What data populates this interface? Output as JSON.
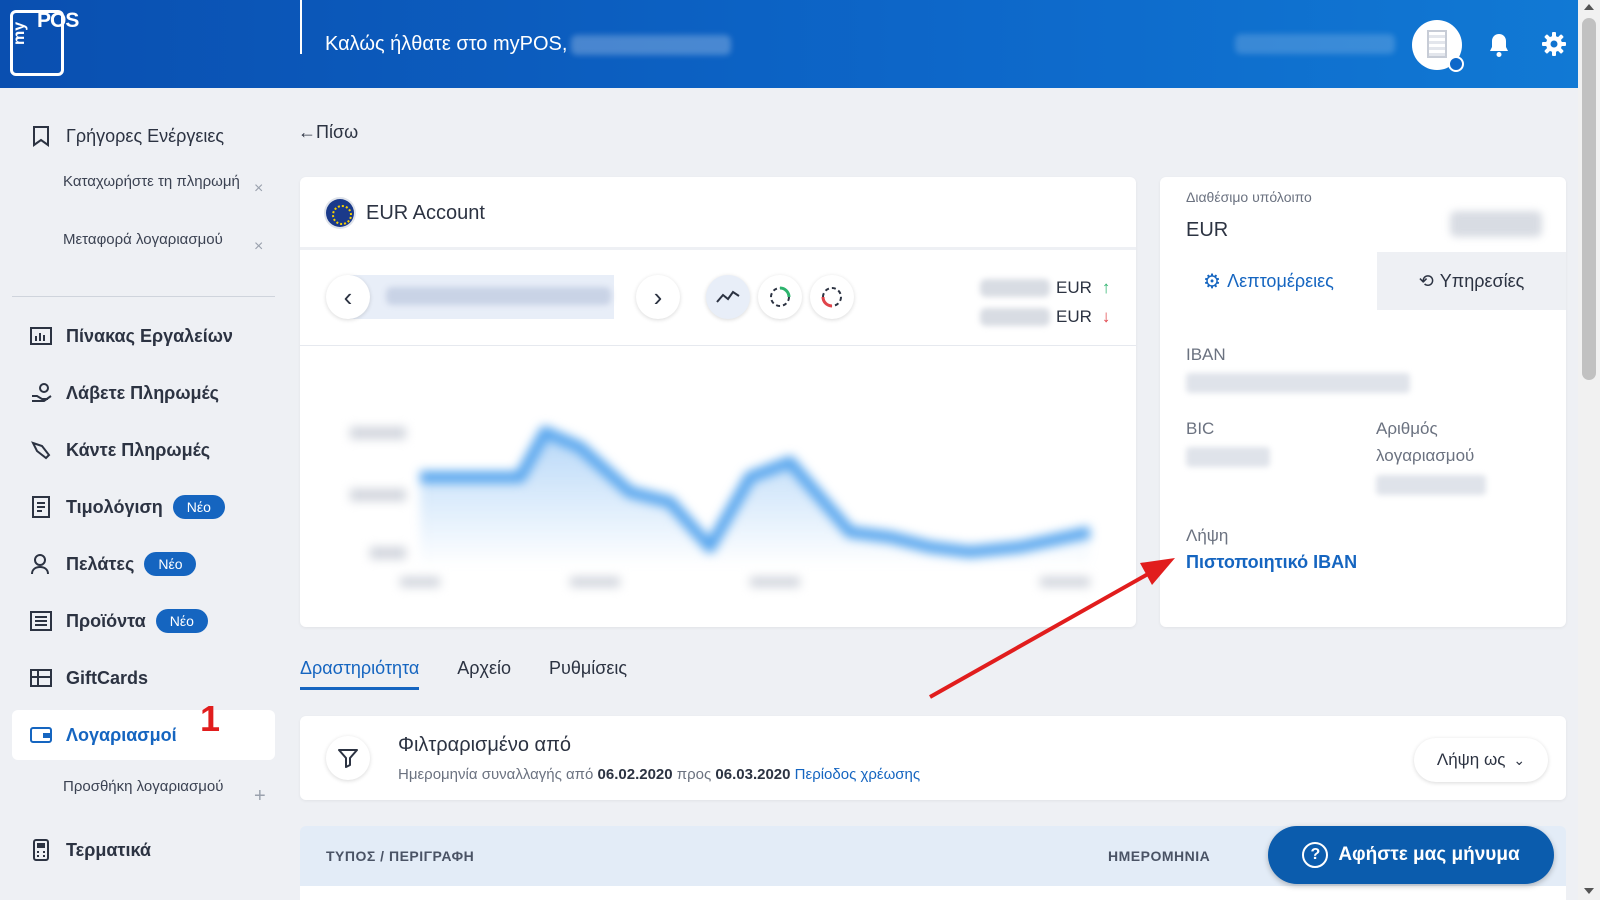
{
  "header": {
    "logo_text_pos": "POS",
    "logo_text_my": "my",
    "welcome": "Καλώς ήλθατε στο myPOS,"
  },
  "sidebar": {
    "quick_actions": "Γρήγορες Ενέργειες",
    "quick_sub": [
      {
        "label": "Καταχωρήστε τη πληρωμή"
      },
      {
        "label": "Μεταφορά λογαριασμού"
      }
    ],
    "remove_symbol": "×",
    "items": [
      {
        "label": "Πίνακας Εργαλείων"
      },
      {
        "label": "Λάβετε Πληρωμές"
      },
      {
        "label": "Κάντε Πληρωμές"
      },
      {
        "label": "Τιμολόγιση",
        "badge": "Νέο"
      },
      {
        "label": "Πελάτες",
        "badge": "Νέο"
      },
      {
        "label": "Προϊόντα",
        "badge": "Νέο"
      },
      {
        "label": "GiftCards"
      },
      {
        "label": "Λογαριασμοί"
      },
      {
        "label": "Τερματικά"
      }
    ],
    "accounts_sub": "Προσθήκη λογαριασμού",
    "add_symbol": "+",
    "step_number": "1"
  },
  "main": {
    "back": "Πίσω",
    "account_title": "EUR Account",
    "prev_symbol": "‹",
    "next_symbol": "›",
    "currency_in": "EUR",
    "currency_out": "EUR",
    "up_arrow": "↑",
    "down_arrow": "↓"
  },
  "balance": {
    "available_label": "Διαθέσιμο υπόλοιπο",
    "currency": "EUR",
    "tab_details": "Λεπτομέρειες",
    "tab_services": "Υπηρεσίες",
    "iban_label": "IBAN",
    "bic_label": "BIC",
    "account_number_label": "Αριθμός λογαριασμού",
    "download_label": "Λήψη",
    "certificate_link": "Πιστοποιητικό IBAN"
  },
  "tabs": [
    {
      "label": "Δραστηριότητα"
    },
    {
      "label": "Αρχείο"
    },
    {
      "label": "Ρυθμίσεις"
    }
  ],
  "filter": {
    "title": "Φιλτραρισμένο από",
    "desc_prefix": "Ημερομηνία συναλλαγής από",
    "date_from": "06.02.2020",
    "desc_mid": "προς",
    "date_to": "06.03.2020",
    "period_link": "Περίοδος χρέωσης",
    "download_as": "Λήψη ως"
  },
  "table": {
    "col_type": "ΤΥΠΟΣ / ΠΕΡΙΓΡΑΦΗ",
    "col_date": "ΗΜΕΡΟΜΗΝΙΑ"
  },
  "chat": {
    "label": "Αφήστε μας μήνυμα",
    "q": "?"
  },
  "colors": {
    "header_blue": "#0d67c9",
    "accent": "#1565c0",
    "annotation_red": "#e11d1d"
  }
}
